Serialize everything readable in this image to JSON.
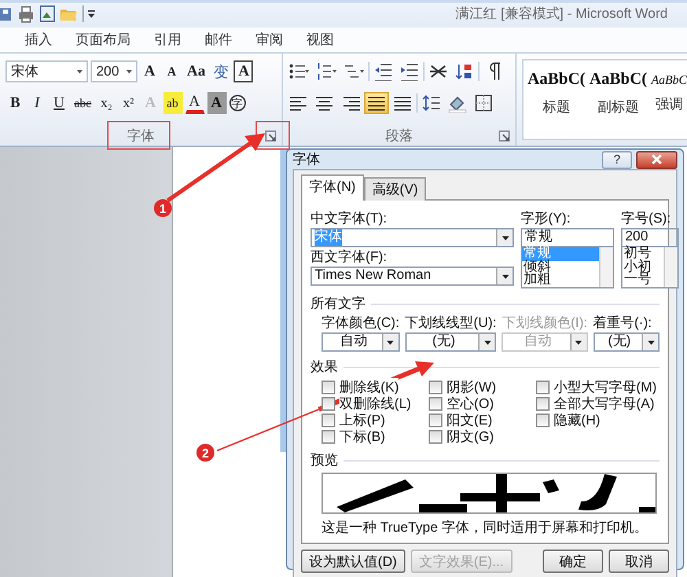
{
  "window": {
    "title": "满江红 [兼容模式] - Microsoft Word"
  },
  "ribbon_tabs": [
    {
      "label": "插入"
    },
    {
      "label": "页面布局"
    },
    {
      "label": "引用"
    },
    {
      "label": "邮件"
    },
    {
      "label": "审阅"
    },
    {
      "label": "视图"
    }
  ],
  "font_group": {
    "label": "字体",
    "font_name": "宋体",
    "font_size": "200",
    "row1": [
      {
        "kind": "grow",
        "label": "A"
      },
      {
        "kind": "shrink",
        "label": "A"
      },
      {
        "kind": "case",
        "label": "Aa"
      },
      {
        "kind": "phonetic",
        "label": "变"
      },
      {
        "kind": "border",
        "label": "A"
      }
    ],
    "row2": [
      {
        "kind": "bold",
        "label": "B"
      },
      {
        "kind": "italic",
        "label": "I"
      },
      {
        "kind": "underline",
        "label": "U"
      },
      {
        "kind": "strike",
        "label": "abc"
      },
      {
        "kind": "sub",
        "label": "x₂"
      },
      {
        "kind": "sup",
        "label": "x²"
      },
      {
        "kind": "effect",
        "label": "A"
      },
      {
        "kind": "highlight",
        "label": "ab"
      },
      {
        "kind": "color",
        "label": "A"
      },
      {
        "kind": "shade",
        "label": "A"
      },
      {
        "kind": "enclose",
        "label": "字"
      }
    ]
  },
  "paragraph_group": {
    "label": "段落",
    "align_buttons": [
      {
        "selected": false
      },
      {
        "selected": false
      },
      {
        "selected": false
      },
      {
        "selected": true
      },
      {
        "selected": false
      }
    ]
  },
  "styles": [
    {
      "sample": "AaBbC(",
      "label": "标题",
      "kind": "heading"
    },
    {
      "sample": "AaBbC(",
      "label": "副标题",
      "kind": "heading"
    },
    {
      "sample": "AaBbC",
      "label": "强调",
      "kind": "emphasis"
    }
  ],
  "dialog": {
    "title": "字体",
    "help": "?",
    "tabs": [
      {
        "label": "字体(N)",
        "selected": true
      },
      {
        "label": "高级(V)",
        "selected": false
      }
    ],
    "chinese_font": {
      "label": "中文字体(T):",
      "value": "宋体",
      "text_selected": true
    },
    "western_font": {
      "label": "西文字体(F):",
      "value": "Times New Roman",
      "text_selected": false
    },
    "font_style": {
      "label": "字形(Y):",
      "value": "常规",
      "options": [
        {
          "label": "常规",
          "selected": true
        },
        {
          "label": "倾斜",
          "selected": false
        },
        {
          "label": "加粗",
          "selected": false
        }
      ]
    },
    "font_size": {
      "label": "字号(S):",
      "value": "200",
      "options": [
        {
          "label": "初号",
          "selected": false
        },
        {
          "label": "小初",
          "selected": false
        },
        {
          "label": "一号",
          "selected": false
        }
      ]
    },
    "all_text": {
      "heading": "所有文字",
      "fields": [
        {
          "label": "字体颜色(C):",
          "value": "自动",
          "disabled": false
        },
        {
          "label": "下划线线型(U):",
          "value": "(无)",
          "disabled": false
        },
        {
          "label": "下划线颜色(I):",
          "value": "自动",
          "disabled": true
        },
        {
          "label": "着重号(·):",
          "value": "(无)",
          "disabled": false
        }
      ]
    },
    "effects": {
      "heading": "效果",
      "columns": [
        [
          {
            "label": "删除线(K)",
            "checked": false
          },
          {
            "label": "双删除线(L)",
            "checked": false
          },
          {
            "label": "上标(P)",
            "checked": false
          },
          {
            "label": "下标(B)",
            "checked": false
          }
        ],
        [
          {
            "label": "阴影(W)",
            "checked": false
          },
          {
            "label": "空心(O)",
            "checked": false
          },
          {
            "label": "阳文(E)",
            "checked": false
          },
          {
            "label": "阴文(G)",
            "checked": false
          }
        ],
        [
          {
            "label": "小型大写字母(M)",
            "checked": false
          },
          {
            "label": "全部大写字母(A)",
            "checked": false
          },
          {
            "label": "隐藏(H)",
            "checked": false
          }
        ]
      ]
    },
    "preview": {
      "heading": "预览",
      "note": "这是一种 TrueType 字体，同时适用于屏幕和打印机。"
    },
    "buttons": [
      {
        "label": "设为默认值(D)",
        "disabled": false
      },
      {
        "label": "文字效果(E)...",
        "disabled": true
      },
      {
        "label": "确定",
        "disabled": false
      },
      {
        "label": "取消",
        "disabled": false
      }
    ]
  },
  "annotations": [
    {
      "number": "1"
    },
    {
      "number": "2"
    }
  ]
}
